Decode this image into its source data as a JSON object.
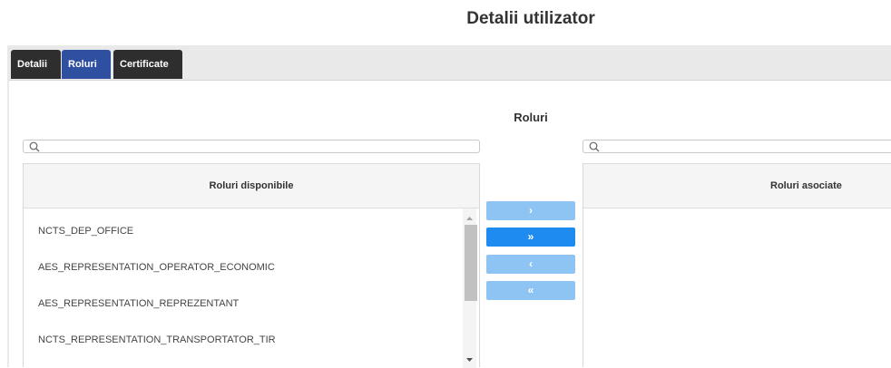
{
  "page": {
    "title": "Detalii utilizator"
  },
  "tabs": [
    {
      "label": "Detalii",
      "active": false
    },
    {
      "label": "Roluri",
      "active": true
    },
    {
      "label": "Certificate",
      "active": false
    }
  ],
  "section": {
    "title": "Roluri"
  },
  "available": {
    "search_value": "",
    "header": "Roluri disponibile",
    "items": [
      "NCTS_DEP_OFFICE",
      "AES_REPRESENTATION_OPERATOR_ECONOMIC",
      "AES_REPRESENTATION_REPREZENTANT",
      "NCTS_REPRESENTATION_TRANSPORTATOR_TIR"
    ]
  },
  "assigned": {
    "search_value": "",
    "header": "Roluri asociate",
    "items": []
  },
  "transfer_buttons": {
    "move_right": "›",
    "move_all_right": "»",
    "move_left": "‹",
    "move_all_left": "«"
  },
  "colors": {
    "active_tab": "#2f4fa0",
    "inactive_tab": "#2e2e2e",
    "button_light": "#8dc4f4",
    "button_strong": "#1e8bf0"
  },
  "icons": {
    "search": "search-icon",
    "scroll_up": "chevron-up-icon",
    "scroll_down": "chevron-down-icon"
  }
}
